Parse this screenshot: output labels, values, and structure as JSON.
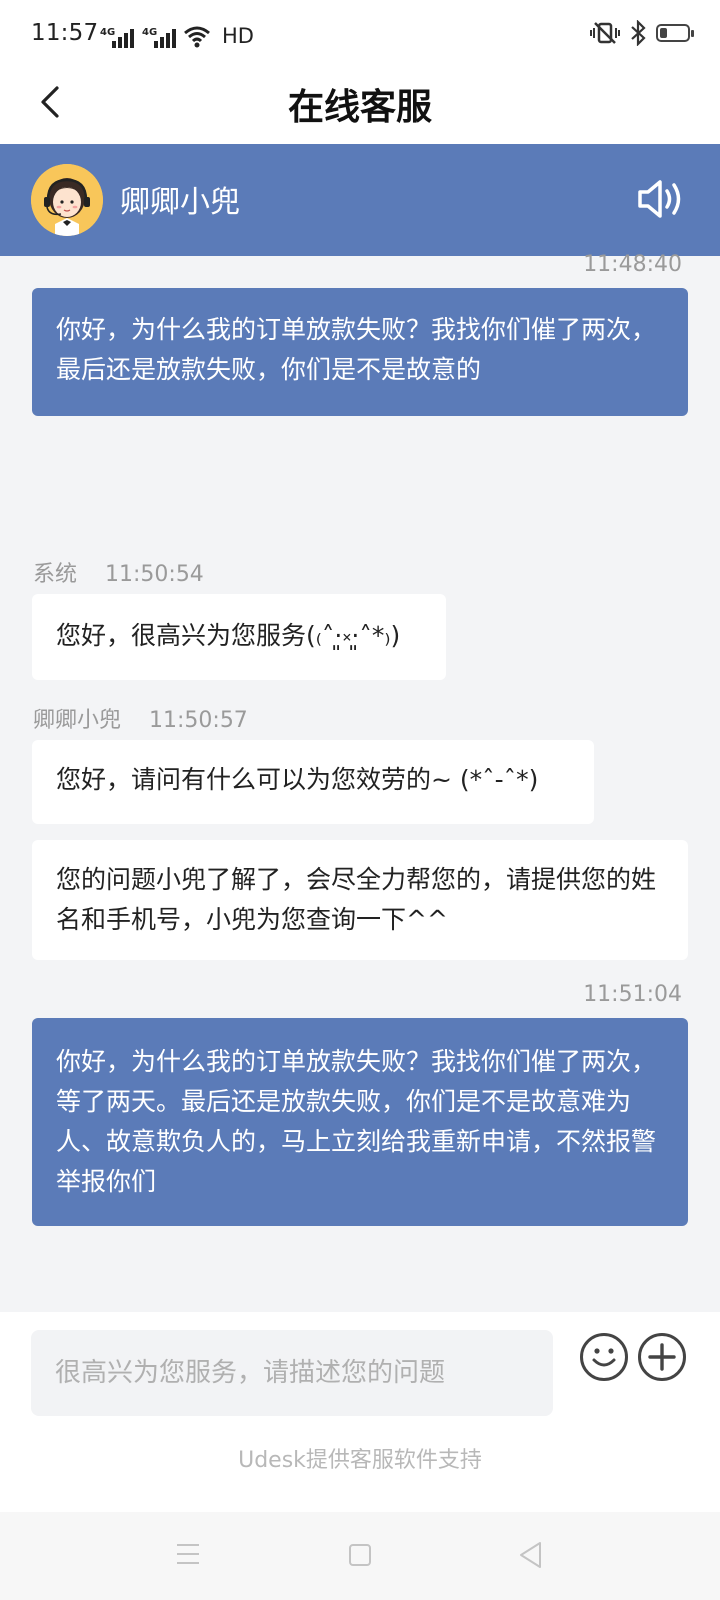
{
  "status_bar": {
    "time": "11:57",
    "network_1": "4G",
    "network_2": "4G",
    "hd": "HD"
  },
  "header": {
    "title": "在线客服"
  },
  "agent": {
    "name": "卿卿小兜"
  },
  "messages": [
    {
      "timestamp": "11:48:40",
      "from": "user",
      "text": "你好，为什么我的订单放款失败？我找你们催了两次，最后还是放款失败，你们是不是故意的"
    },
    {
      "sender": "系统",
      "time": "11:50:54",
      "from": "system",
      "text": "您好，很高兴为您服务(₍˄·͈༝·͈˄*₎)"
    },
    {
      "sender": "卿卿小兜",
      "time": "11:50:57",
      "from": "agent",
      "text": "您好，请问有什么可以为您效劳的~ (*ˆ-ˆ*)"
    },
    {
      "from": "agent",
      "text": "您的问题小兜了解了，会尽全力帮您的，请提供您的姓名和手机号，小兜为您查询一下^^"
    },
    {
      "timestamp": "11:51:04",
      "from": "user",
      "text": "你好，为什么我的订单放款失败？我找你们催了两次，等了两天。最后还是放款失败，你们是不是故意难为人、故意欺负人的，马上立刻给我重新申请，不然报警举报你们"
    }
  ],
  "input": {
    "placeholder": "很高兴为您服务，请描述您的问题",
    "value": ""
  },
  "footer": {
    "powered_by": "Udesk提供客服软件支持"
  },
  "colors": {
    "brand": "#5b7bb8",
    "background": "#f3f4f6"
  }
}
